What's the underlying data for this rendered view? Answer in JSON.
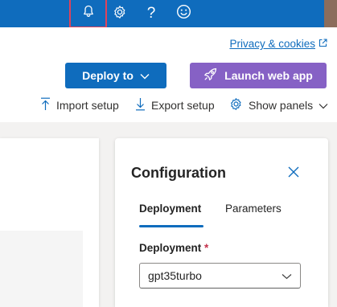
{
  "topbar": {
    "icons": [
      "bell-icon",
      "gear-icon",
      "help-icon",
      "feedback-icon"
    ],
    "help_glyph": "?"
  },
  "header": {
    "privacy_link": "Privacy & cookies",
    "deploy_button": "Deploy to",
    "launch_button": "Launch web app",
    "tools": {
      "import": "Import setup",
      "export": "Export setup",
      "show_panels": "Show panels"
    }
  },
  "config": {
    "title": "Configuration",
    "tabs": [
      {
        "label": "Deployment",
        "active": true
      },
      {
        "label": "Parameters",
        "active": false
      }
    ],
    "deployment_label": "Deployment",
    "required_mark": "*",
    "deployment_value": "gpt35turbo"
  },
  "colors": {
    "brand": "#0f6cbd",
    "launch": "#8661c5",
    "highlight": "#e0435a"
  }
}
